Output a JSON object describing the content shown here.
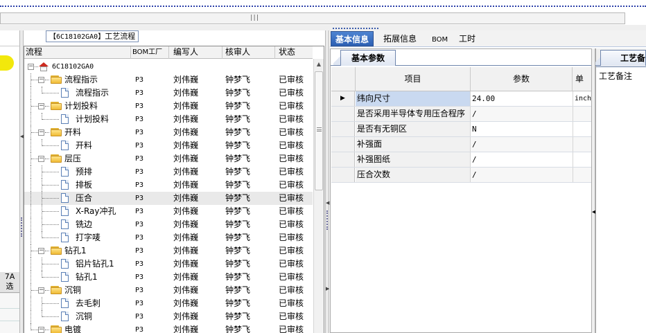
{
  "left_stub": {
    "bottom_text_line1": "7A",
    "bottom_text_line2": "选"
  },
  "process_group": {
    "code": "【6C18102GA0】",
    "title": "工艺流程"
  },
  "tree": {
    "headers": {
      "flow": "流程",
      "bom": "BOM工厂",
      "writer": "编写人",
      "reviewer": "核审人",
      "status": "状态"
    },
    "root": "6C18102GA0",
    "rows": [
      {
        "label": "流程指示",
        "kind": "folder",
        "level": 1,
        "bom": "P3",
        "writer": "刘伟巍",
        "reviewer": "钟梦飞",
        "status": "已审核"
      },
      {
        "label": "流程指示",
        "kind": "doc",
        "level": 2,
        "bom": "P3",
        "writer": "刘伟巍",
        "reviewer": "钟梦飞",
        "status": "已审核"
      },
      {
        "label": "计划投料",
        "kind": "folder",
        "level": 1,
        "bom": "P3",
        "writer": "刘伟巍",
        "reviewer": "钟梦飞",
        "status": "已审核"
      },
      {
        "label": "计划投料",
        "kind": "doc",
        "level": 2,
        "bom": "P3",
        "writer": "刘伟巍",
        "reviewer": "钟梦飞",
        "status": "已审核"
      },
      {
        "label": "开料",
        "kind": "folder",
        "level": 1,
        "bom": "P3",
        "writer": "刘伟巍",
        "reviewer": "钟梦飞",
        "status": "已审核"
      },
      {
        "label": "开料",
        "kind": "doc",
        "level": 2,
        "bom": "P3",
        "writer": "刘伟巍",
        "reviewer": "钟梦飞",
        "status": "已审核"
      },
      {
        "label": "层压",
        "kind": "folder",
        "level": 1,
        "bom": "P3",
        "writer": "刘伟巍",
        "reviewer": "钟梦飞",
        "status": "已审核"
      },
      {
        "label": "预排",
        "kind": "doc",
        "level": 2,
        "bom": "P3",
        "writer": "刘伟巍",
        "reviewer": "钟梦飞",
        "status": "已审核"
      },
      {
        "label": "排板",
        "kind": "doc",
        "level": 2,
        "bom": "P3",
        "writer": "刘伟巍",
        "reviewer": "钟梦飞",
        "status": "已审核"
      },
      {
        "label": "压合",
        "kind": "doc",
        "level": 2,
        "bom": "P3",
        "writer": "刘伟巍",
        "reviewer": "钟梦飞",
        "status": "已审核",
        "selected": true
      },
      {
        "label": "X-Ray冲孔",
        "kind": "doc",
        "level": 2,
        "bom": "P3",
        "writer": "刘伟巍",
        "reviewer": "钟梦飞",
        "status": "已审核"
      },
      {
        "label": "铣边",
        "kind": "doc",
        "level": 2,
        "bom": "P3",
        "writer": "刘伟巍",
        "reviewer": "钟梦飞",
        "status": "已审核"
      },
      {
        "label": "打字唛",
        "kind": "doc",
        "level": 2,
        "bom": "P3",
        "writer": "刘伟巍",
        "reviewer": "钟梦飞",
        "status": "已审核"
      },
      {
        "label": "钻孔1",
        "kind": "folder",
        "level": 1,
        "bom": "P3",
        "writer": "刘伟巍",
        "reviewer": "钟梦飞",
        "status": "已审核"
      },
      {
        "label": "铝片钻孔1",
        "kind": "doc",
        "level": 2,
        "bom": "P3",
        "writer": "刘伟巍",
        "reviewer": "钟梦飞",
        "status": "已审核"
      },
      {
        "label": "钻孔1",
        "kind": "doc",
        "level": 2,
        "bom": "P3",
        "writer": "刘伟巍",
        "reviewer": "钟梦飞",
        "status": "已审核"
      },
      {
        "label": "沉铜",
        "kind": "folder",
        "level": 1,
        "bom": "P3",
        "writer": "刘伟巍",
        "reviewer": "钟梦飞",
        "status": "已审核"
      },
      {
        "label": "去毛刺",
        "kind": "doc",
        "level": 2,
        "bom": "P3",
        "writer": "刘伟巍",
        "reviewer": "钟梦飞",
        "status": "已审核"
      },
      {
        "label": "沉铜",
        "kind": "doc",
        "level": 2,
        "bom": "P3",
        "writer": "刘伟巍",
        "reviewer": "钟梦飞",
        "status": "已审核"
      },
      {
        "label": "电镀",
        "kind": "folder",
        "level": 1,
        "bom": "P3",
        "writer": "刘伟巍",
        "reviewer": "钟梦飞",
        "status": "已审核"
      }
    ]
  },
  "tabs": {
    "basic": "基本信息",
    "extended": "拓展信息",
    "bom": "BOM",
    "hours": "工时"
  },
  "basic_params": {
    "tab_label": "基本参数",
    "headers": {
      "item": "项目",
      "param": "参数",
      "unit": "单"
    },
    "rows": [
      {
        "item": "纬向尺寸",
        "value": "24.00",
        "unit": "inch",
        "current": true
      },
      {
        "item": "是否采用半导体专用压合程序",
        "value": "/",
        "unit": ""
      },
      {
        "item": "是否有无铜区",
        "value": "N",
        "unit": ""
      },
      {
        "item": "补强面",
        "value": "/",
        "unit": ""
      },
      {
        "item": "补强图纸",
        "value": "/",
        "unit": ""
      },
      {
        "item": "压合次数",
        "value": "/",
        "unit": ""
      }
    ]
  },
  "process_notes": {
    "tab_label": "工艺备",
    "label": "工艺备注"
  },
  "colors": {
    "active_tab": "#2b5fb3",
    "selected_row": "#e9e9e9",
    "current_cell": "#c9d9f0",
    "accent_dots": "#2b3fa8"
  }
}
